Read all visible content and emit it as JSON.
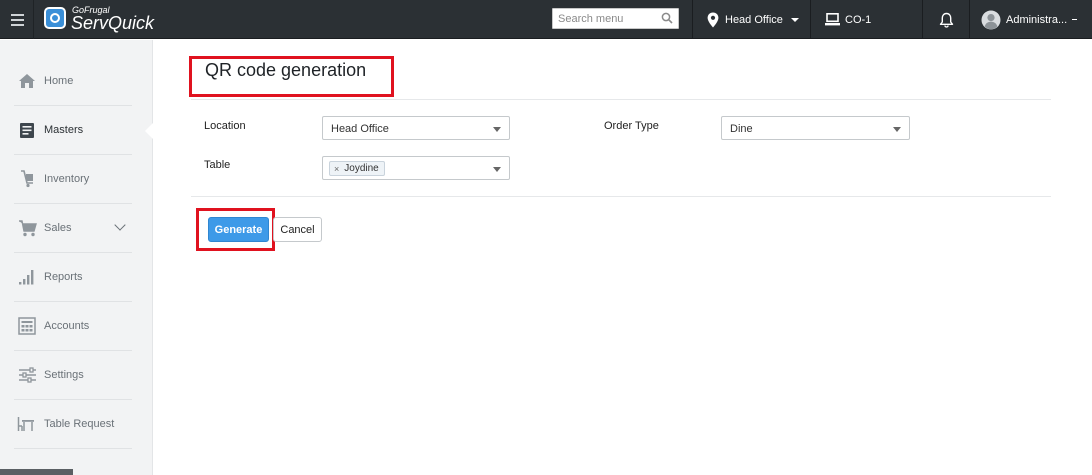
{
  "topbar": {
    "brand_small": "GoFrugal",
    "brand_name": "ServQuick",
    "search_placeholder": "Search menu",
    "location": "Head Office",
    "counter": "CO-1",
    "user": "Administra..."
  },
  "sidebar": {
    "items": [
      {
        "label": "Home",
        "icon": "home-icon"
      },
      {
        "label": "Masters",
        "icon": "masters-icon",
        "active": true
      },
      {
        "label": "Inventory",
        "icon": "inventory-icon"
      },
      {
        "label": "Sales",
        "icon": "cart-icon"
      },
      {
        "label": "Reports",
        "icon": "bar-chart-icon"
      },
      {
        "label": "Accounts",
        "icon": "accounts-icon"
      },
      {
        "label": "Settings",
        "icon": "sliders-icon"
      },
      {
        "label": "Table Request",
        "icon": "table-icon"
      }
    ]
  },
  "main": {
    "title": "QR code generation",
    "location_label": "Location",
    "location_value": "Head Office",
    "order_type_label": "Order Type",
    "order_type_value": "Dine",
    "table_label": "Table",
    "table_tag": "Joydine",
    "generate_label": "Generate",
    "cancel_label": "Cancel"
  },
  "colors": {
    "topbar": "#2b3034",
    "sidebar": "#f2f3f4",
    "primary_button": "#3d9ae8",
    "highlight_box": "#e0121f"
  }
}
